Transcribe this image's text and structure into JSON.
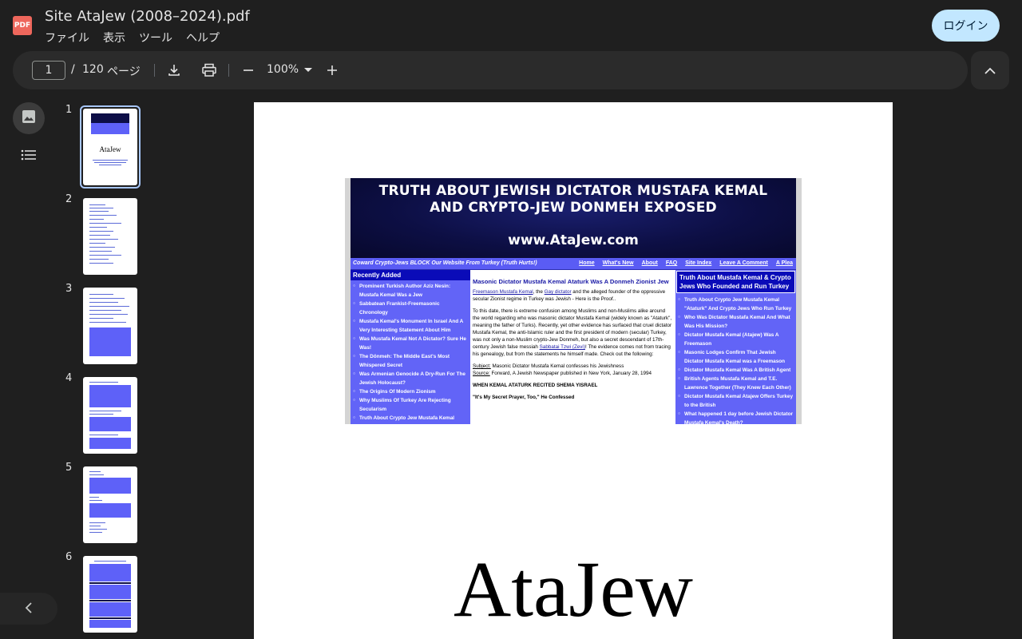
{
  "app": {
    "logo_text": "PDF",
    "doc_title": "Site AtaJew (2008–2024).pdf",
    "menu": [
      "ファイル",
      "表示",
      "ツール",
      "ヘルプ"
    ],
    "login_label": "ログイン"
  },
  "toolbar": {
    "current_page": "1",
    "separator": "/",
    "total_pages": "120",
    "pages_label": "ページ",
    "zoom": "100%",
    "icons": [
      "download-icon",
      "print-icon",
      "zoom-out-icon",
      "zoom-in-icon",
      "chevron-up-icon"
    ]
  },
  "rail": {
    "icons": [
      "image-icon",
      "list-icon",
      "chevron-left-icon"
    ]
  },
  "thumbnails": {
    "numbers": [
      "1",
      "2",
      "3",
      "4",
      "5",
      "6"
    ],
    "selected": "1",
    "thumb1_title": "AtaJew"
  },
  "page": {
    "banner_line1": "TRUTH ABOUT JEWISH DICTATOR MUSTAFA KEMAL",
    "banner_line2": "AND CRYPTO-JEW DONMEH EXPOSED",
    "banner_url": "www.AtaJew.com",
    "slogan": "Coward Crypto-Jews BLOCK Our Website From Turkey (Truth Hurts!)",
    "nav_links": [
      "Home",
      "What's New",
      "About",
      "FAQ",
      "Site Index",
      "Leave A Comment",
      "A Plea"
    ],
    "left_head": "Recently Added",
    "left_items": [
      "Prominent Turkish Author Aziz Nesin: Mustafa Kemal Was a Jew",
      "Sabbatean Frankist-Freemasonic Chronology",
      "Mustafa Kemal's Monument In Israel And A Very Interesting Statement About Him",
      "Was Mustafa Kemal Not A Dictator? Sure He Was!",
      "The Dönmeh: The Middle East's Most Whispered Secret",
      "Was Armenian Genocide A Dry-Run For The Jewish Holocaust?",
      "The Origins Of Modern Zionism",
      "Why Muslims Of Turkey Are Rejecting Secularism",
      "Truth About Crypto Jew Mustafa Kemal"
    ],
    "mid_title": "Masonic Dictator Mustafa Kemal Ataturk Was A Donmeh Zionist Jew",
    "mid_link1": "Freemason Mustafa Kemal",
    "mid_text1": ", the ",
    "mid_link2": "Gay dictator",
    "mid_text2": " and the alleged founder of the oppressive secular Zionist regime in Turkey was Jewish - Here is the Proof..",
    "mid_para2a": "To this date, there is extreme confusion among Muslims and non-Muslims alike around the world regarding who was masonic dictator Mustafa Kemal (widely known as \"Ataturk\", meaning the father of Turks). Recently, yet other evidence has surfaced that cruel dictator Mustafa Kemal, the anti-Islamic ruler and the first president of modern (secular) Turkey, was not only a non-Muslim crypto-Jew Donmeh, but also a secret descendant of 17th-century Jewish false messiah ",
    "mid_link3": "Sabbatai Tzwi (Zevi)",
    "mid_para2b": "! The evidence comes not from tracing his genealogy, but from the statements he himself made. Check out the following:",
    "subject_label": "Subject:",
    "subject_text": " Masonic Dictator Mustafa Kemal confesses his Jewishness",
    "source_label": "Source:",
    "source_text": " Forward, A Jewish Newspaper published in New York, January 28, 1994",
    "shema_line": "WHEN KEMAL ATATURK RECITED SHEMA YISRAEL",
    "quote_line": "\"It's My Secret Prayer, Too,\" He Confessed",
    "right_head": "Truth About Mustafa Kemal & Crypto Jews Who Founded and Run Turkey",
    "right_items": [
      "Truth About Crypto Jew Mustafa Kemal \"Ataturk\" And Crypto Jews Who Run Turkey",
      "Who Was Dictator Mustafa Kemal And What Was His Mission?",
      "Dictator Mustafa Kemal (Atajew) Was A Freemason",
      "Masonic Lodges Confirm That Jewish Dictator Mustafa Kemal was a Freemason",
      "Dictator Mustafa Kemal Was A British Agent",
      "British Agents Mustafa Kemal and T.E. Lawrence Together (They Knew Each Other)",
      "Dictator Mustafa Kemal Atajew Offers Turkey to the British",
      "What happened 1 day before Jewish Dictator Mustafa Kemal's Death?"
    ],
    "big_title": "AtaJew"
  }
}
